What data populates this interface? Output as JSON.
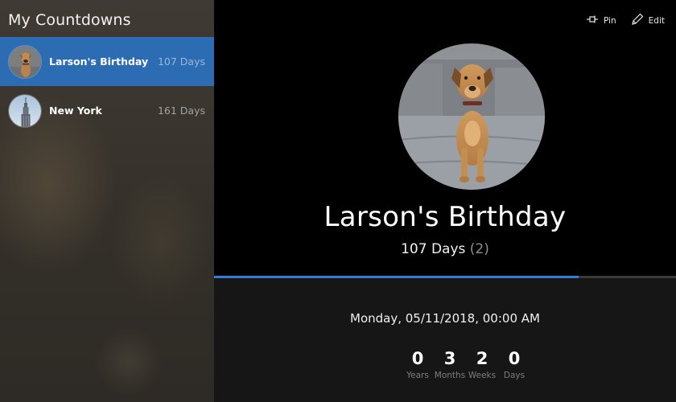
{
  "sidebar": {
    "title": "My Countdowns",
    "items": [
      {
        "label": "Larson's Birthday",
        "days": "107 Days",
        "selected": true
      },
      {
        "label": "New York",
        "days": "161 Days",
        "selected": false
      }
    ]
  },
  "toolbar": {
    "pin_label": "Pin",
    "edit_label": "Edit"
  },
  "detail": {
    "title": "Larson's Birthday",
    "days_text": "107 Days",
    "days_extra": "(2)",
    "progress_fraction": 0.79,
    "date_text": "Monday, 05/11/2018, 00:00 AM",
    "counters": [
      {
        "value": "0",
        "unit": "Years"
      },
      {
        "value": "3",
        "unit": "Months"
      },
      {
        "value": "2",
        "unit": "Weeks"
      },
      {
        "value": "0",
        "unit": "Days"
      }
    ]
  },
  "colors": {
    "accent": "#2b6cb3",
    "progress": "#2e7fd6"
  }
}
